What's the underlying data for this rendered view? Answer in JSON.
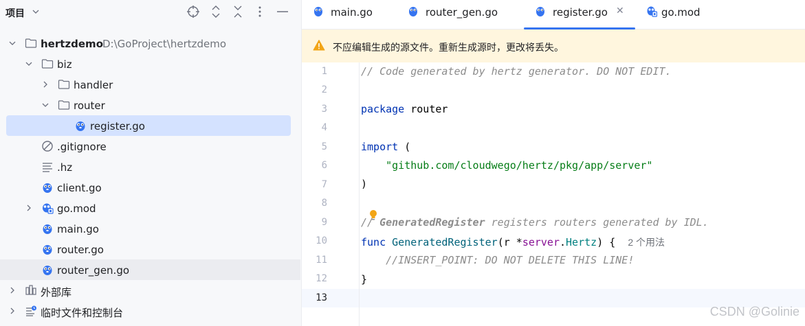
{
  "project": {
    "title": "项目",
    "tree": [
      {
        "label": "hertzdemo",
        "path": "D:\\GoProject\\hertzdemo",
        "icon": "folder-icon",
        "chevron": "down"
      },
      {
        "label": "biz",
        "icon": "folder-icon",
        "chevron": "down"
      },
      {
        "label": "handler",
        "icon": "folder-icon",
        "chevron": "right"
      },
      {
        "label": "router",
        "icon": "folder-icon",
        "chevron": "down"
      },
      {
        "label": "register.go",
        "icon": "go-file-icon",
        "selected": true
      },
      {
        "label": ".gitignore",
        "icon": "ignore-file-icon"
      },
      {
        "label": ".hz",
        "icon": "text-file-icon"
      },
      {
        "label": "client.go",
        "icon": "go-file-icon"
      },
      {
        "label": "go.mod",
        "icon": "go-mod-icon",
        "chevron": "right"
      },
      {
        "label": "main.go",
        "icon": "go-file-icon"
      },
      {
        "label": "router.go",
        "icon": "go-file-icon"
      },
      {
        "label": "router_gen.go",
        "icon": "go-file-icon"
      },
      {
        "label": "外部库",
        "icon": "external-libraries-icon",
        "chevron": "right"
      },
      {
        "label": "临时文件和控制台",
        "icon": "scratches-icon",
        "chevron": "right"
      }
    ]
  },
  "tabs": [
    {
      "label": "main.go",
      "icon": "go-file-icon"
    },
    {
      "label": "router_gen.go",
      "icon": "go-file-icon"
    },
    {
      "label": "register.go",
      "icon": "go-file-icon",
      "active": true
    },
    {
      "label": "go.mod",
      "icon": "go-mod-icon"
    }
  ],
  "banner": {
    "text": "不应编辑生成的源文件。重新生成源时，更改将丢失。"
  },
  "code": {
    "line_numbers": [
      "1",
      "2",
      "3",
      "4",
      "5",
      "6",
      "7",
      "8",
      "9",
      "10",
      "11",
      "12",
      "13"
    ],
    "current_line": 13,
    "l1": "// Code generated by hertz generator. DO NOT EDIT.",
    "kw_package": "package",
    "pkg_router": "router",
    "kw_import": "import",
    "paren_open": " (",
    "import_path": "\"github.com/cloudwego/hertz/pkg/app/server\"",
    "paren_close": ")",
    "l9_prefix": "// ",
    "l9_name": "GeneratedRegister",
    "l9_rest": " registers routers generated by IDL.",
    "kw_func": "func",
    "fn_name": "GeneratedRegister",
    "p_open": "(",
    "param": "r",
    "star": " *",
    "pkg_server": "server",
    "dot": ".",
    "type_hertz": "Hertz",
    "p_close": ") {",
    "usage_hint": "2 个用法",
    "l11": "//INSERT_POINT: DO NOT DELETE THIS LINE!",
    "brace_close": "}"
  },
  "watermark": "CSDN @Golinie",
  "colors": {
    "accent": "#3574f0",
    "selection": "#d4e2ff",
    "banner": "#fff6de",
    "warning": "#f2a516"
  }
}
